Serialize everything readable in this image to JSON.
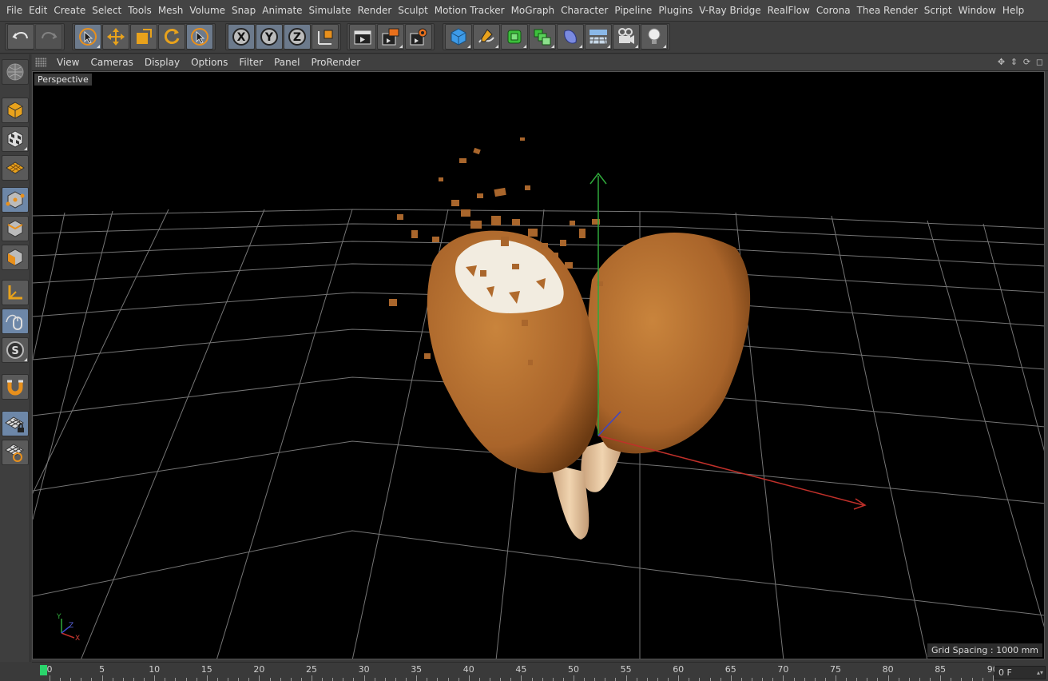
{
  "menubar": {
    "items": [
      "File",
      "Edit",
      "Create",
      "Select",
      "Tools",
      "Mesh",
      "Volume",
      "Snap",
      "Animate",
      "Simulate",
      "Render",
      "Sculpt",
      "Motion Tracker",
      "MoGraph",
      "Character",
      "Pipeline",
      "Plugins",
      "V-Ray Bridge",
      "RealFlow",
      "Corona",
      "Thea Render",
      "Script",
      "Window",
      "Help"
    ]
  },
  "toolbar": {
    "buttons": [
      "undo-icon",
      "redo-icon",
      "live-selection-icon",
      "move-icon",
      "scale-icon",
      "rotate-icon",
      "selection-tool-icon",
      "x-axis-lock-icon",
      "y-axis-lock-icon",
      "z-axis-lock-icon",
      "world-coordinates-icon",
      "render-view-icon",
      "render-picture-viewer-icon",
      "render-settings-icon",
      "cube-object-icon",
      "pen-spline-icon",
      "subdivision-surface-icon",
      "array-generator-icon",
      "deformer-icon",
      "floor-environment-icon",
      "camera-icon",
      "light-icon"
    ],
    "axis_letters": [
      "X",
      "Y",
      "Z"
    ]
  },
  "leftbar": {
    "buttons": [
      "make-editable-icon",
      "model-mode-icon",
      "texture-mode-icon",
      "workplane-mode-icon",
      "points-mode-icon",
      "edges-mode-icon",
      "polygons-mode-icon",
      "axis-mode-icon",
      "tweak-mode-icon",
      "solo-mode-icon",
      "magnet-icon",
      "snap-lock-icon",
      "workplane-snap-icon"
    ],
    "solo_letter": "S"
  },
  "viewport": {
    "menus": [
      "View",
      "Cameras",
      "Display",
      "Options",
      "Filter",
      "Panel",
      "ProRender"
    ],
    "label": "Perspective",
    "grid_spacing": "Grid Spacing : 1000 mm",
    "axis_labels": {
      "y": "Y",
      "z": "Z",
      "x": "X"
    }
  },
  "timeline": {
    "ticks": [
      "0",
      "5",
      "10",
      "15",
      "20",
      "25",
      "30",
      "35",
      "40",
      "45",
      "50",
      "55",
      "60",
      "65",
      "70",
      "75",
      "80",
      "85",
      "90"
    ],
    "current_frame": "0 F"
  },
  "colors": {
    "accent_orange": "#e8901c",
    "highlight_blue": "#6d87a8",
    "playhead_green": "#2ad46b",
    "popsicle_brown": "#b87333",
    "axis_x": "#c0302a",
    "axis_y": "#2fa83a",
    "axis_z": "#3c46c8"
  }
}
